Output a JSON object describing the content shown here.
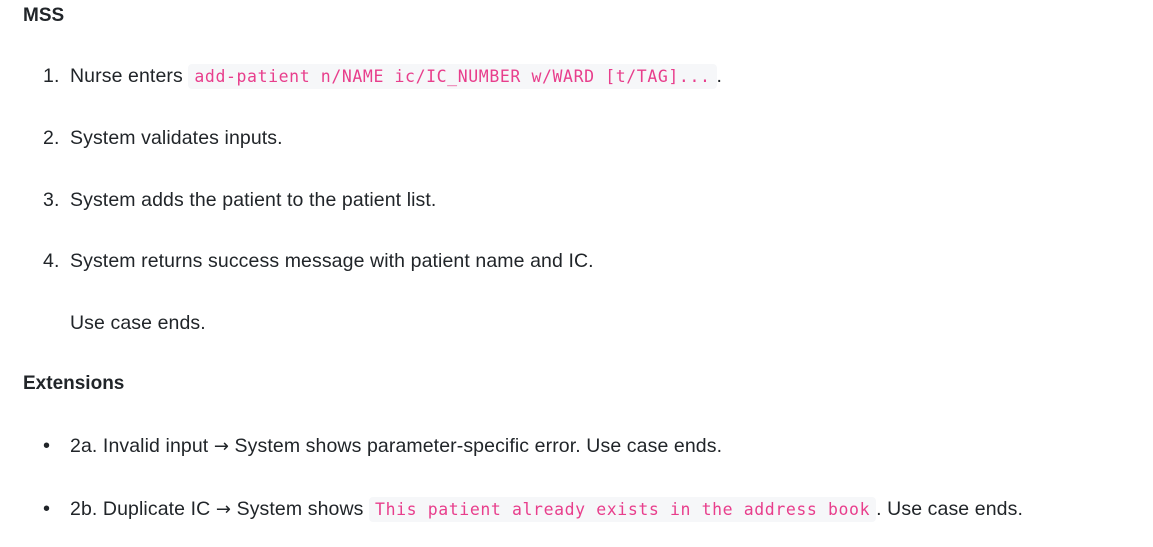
{
  "mss": {
    "heading": "MSS",
    "steps": [
      {
        "num": "1.",
        "before": "Nurse enters",
        "code": "add-patient n/NAME ic/IC_NUMBER w/WARD [t/TAG]...",
        "after": "."
      },
      {
        "num": "2.",
        "text": "System validates inputs."
      },
      {
        "num": "3.",
        "text": "System adds the patient to the patient list."
      },
      {
        "num": "4.",
        "text": "System returns success message with patient name and IC."
      }
    ],
    "end_note": "Use case ends."
  },
  "extensions": {
    "heading": "Extensions",
    "items": [
      {
        "label": "2a. Invalid input",
        "arrow": "→",
        "text": "System shows parameter-specific error. Use case ends."
      },
      {
        "label": "2b. Duplicate IC",
        "arrow": "→",
        "before": "System shows",
        "code": "This patient already exists in the address book",
        "after": ". Use case ends."
      }
    ]
  }
}
